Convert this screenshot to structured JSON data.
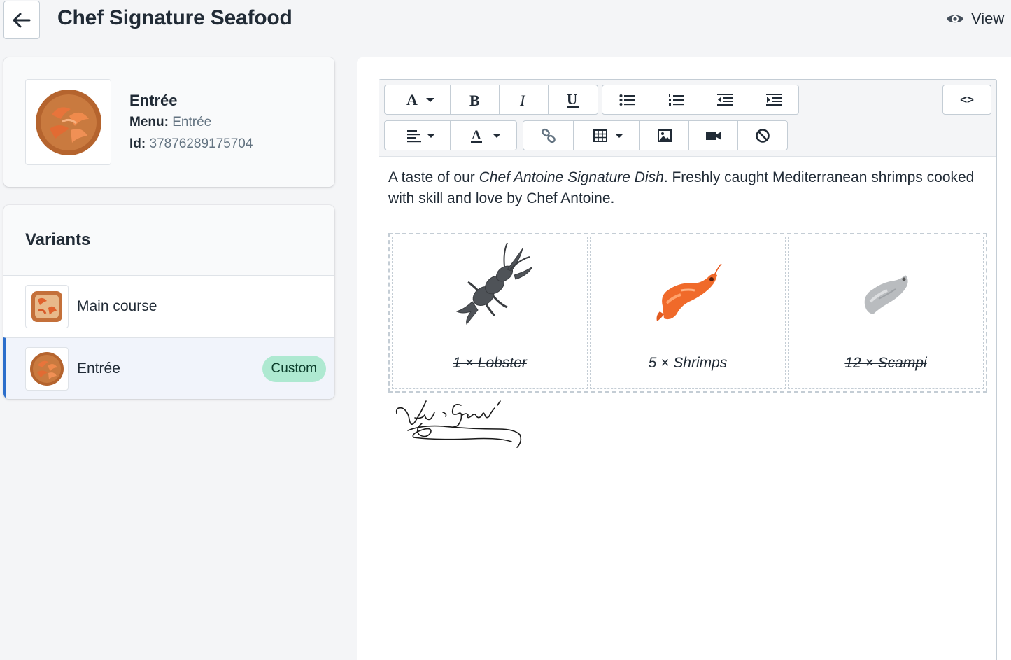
{
  "header": {
    "title": "Chef Signature Seafood",
    "view_label": "View"
  },
  "product": {
    "name": "Entrée",
    "menu_label": "Menu:",
    "menu_value": "Entrée",
    "id_label": "Id:",
    "id_value": "37876289175704"
  },
  "variants": {
    "title": "Variants",
    "items": [
      {
        "label": "Main course",
        "selected": false
      },
      {
        "label": "Entrée",
        "selected": true,
        "badge": "Custom"
      }
    ]
  },
  "toolbar": {
    "row1": [
      "font-style",
      "bold",
      "italic",
      "underline",
      "bullet-list",
      "numbered-list",
      "outdent",
      "indent"
    ],
    "row2": [
      "align",
      "text-color",
      "link",
      "table",
      "image",
      "video",
      "clear-format"
    ],
    "code_view_label": "<>"
  },
  "content": {
    "intro_before": "A taste of our ",
    "intro_italic": "Chef Antoine Signature Dish",
    "intro_after": ". Freshly caught Mediterranean shrimps cooked with skill and love by Chef Antoine.",
    "items": [
      {
        "label": "1 × Lobster",
        "struck": true
      },
      {
        "label": "5 × Shrimps",
        "struck": false
      },
      {
        "label": "12 × Scampi",
        "struck": true
      }
    ]
  },
  "colors": {
    "accent": "#2c6ecb",
    "badge_bg": "#aee9d1",
    "shrimp": "#f06a2a"
  }
}
